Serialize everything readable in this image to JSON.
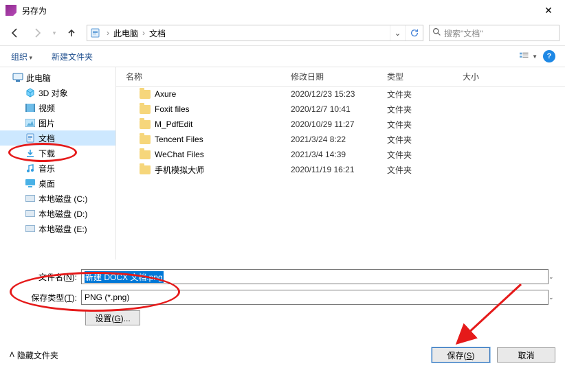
{
  "title": "另存为",
  "nav": {
    "crumb1": "此电脑",
    "crumb2": "文档",
    "search_placeholder": "搜索\"文档\""
  },
  "toolbar": {
    "organize": "组织",
    "new_folder": "新建文件夹"
  },
  "sidebar": {
    "pc": "此电脑",
    "objects3d": "3D 对象",
    "videos": "视频",
    "pictures": "图片",
    "documents": "文档",
    "downloads": "下载",
    "music": "音乐",
    "desktop": "桌面",
    "disk_c": "本地磁盘 (C:)",
    "disk_d": "本地磁盘 (D:)",
    "disk_e": "本地磁盘 (E:)"
  },
  "columns": {
    "name": "名称",
    "date": "修改日期",
    "type": "类型",
    "size": "大小"
  },
  "rows": [
    {
      "name": "Axure",
      "date": "2020/12/23 15:23",
      "type": "文件夹"
    },
    {
      "name": "Foxit files",
      "date": "2020/12/7 10:41",
      "type": "文件夹"
    },
    {
      "name": "M_PdfEdit",
      "date": "2020/10/29 11:27",
      "type": "文件夹"
    },
    {
      "name": "Tencent Files",
      "date": "2021/3/24 8:22",
      "type": "文件夹"
    },
    {
      "name": "WeChat Files",
      "date": "2021/3/4 14:39",
      "type": "文件夹"
    },
    {
      "name": "手机模拟大师",
      "date": "2020/11/19 16:21",
      "type": "文件夹"
    }
  ],
  "form": {
    "filename_label_pre": "文件名(",
    "filename_label_key": "N",
    "filename_label_post": "):",
    "filename_value": "新建 DOCX 文档.png",
    "filetype_label_pre": "保存类型(",
    "filetype_label_key": "T",
    "filetype_label_post": "):",
    "filetype_value": "PNG (*.png)",
    "settings_pre": "设置(",
    "settings_key": "G",
    "settings_post": ")..."
  },
  "footer": {
    "hide_folders": "隐藏文件夹",
    "save_pre": "保存(",
    "save_key": "S",
    "save_post": ")",
    "cancel": "取消"
  }
}
